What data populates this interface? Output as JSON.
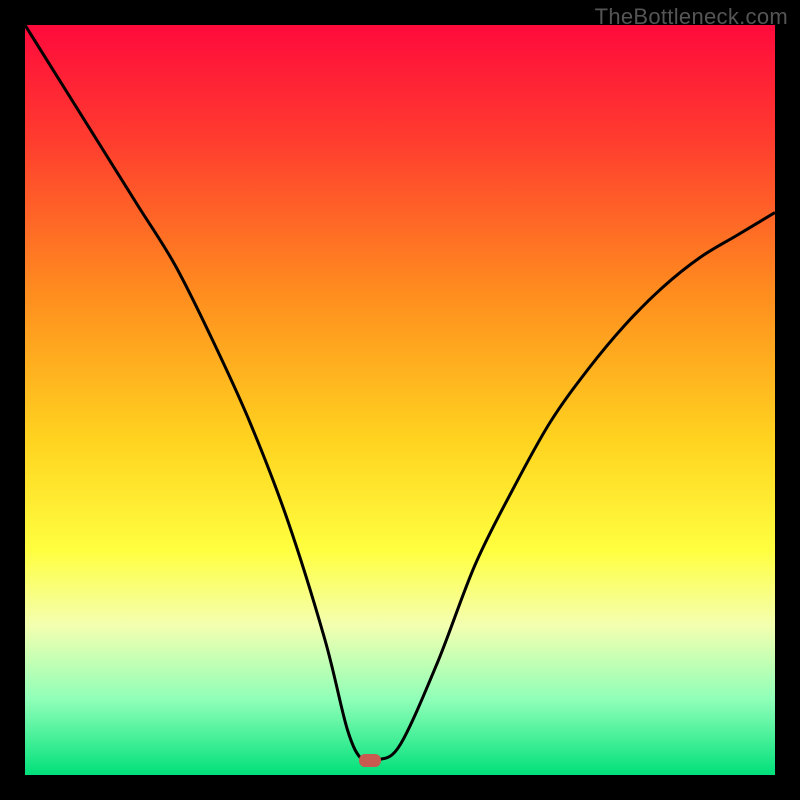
{
  "watermark": "TheBottleneck.com",
  "chart_data": {
    "type": "line",
    "title": "",
    "xlabel": "",
    "ylabel": "",
    "xlim": [
      0,
      100
    ],
    "ylim": [
      0,
      100
    ],
    "gradient_stops": [
      {
        "offset": 0,
        "color": "#ff0a3c"
      },
      {
        "offset": 15,
        "color": "#ff3b2f"
      },
      {
        "offset": 35,
        "color": "#ff8a1f"
      },
      {
        "offset": 55,
        "color": "#ffd21f"
      },
      {
        "offset": 70,
        "color": "#ffff3f"
      },
      {
        "offset": 80,
        "color": "#f4ffb0"
      },
      {
        "offset": 90,
        "color": "#8fffb8"
      },
      {
        "offset": 100,
        "color": "#00e07a"
      }
    ],
    "series": [
      {
        "name": "curve",
        "x": [
          0,
          5,
          10,
          15,
          20,
          25,
          30,
          35,
          40,
          43,
          45,
          47,
          50,
          55,
          60,
          65,
          70,
          75,
          80,
          85,
          90,
          95,
          100
        ],
        "values": [
          100,
          92,
          84,
          76,
          68,
          58,
          47,
          34,
          18,
          6,
          2,
          2,
          4,
          15,
          28,
          38,
          47,
          54,
          60,
          65,
          69,
          72,
          75
        ]
      }
    ],
    "marker": {
      "x": 46,
      "y": 2,
      "color": "#c85a50"
    }
  }
}
